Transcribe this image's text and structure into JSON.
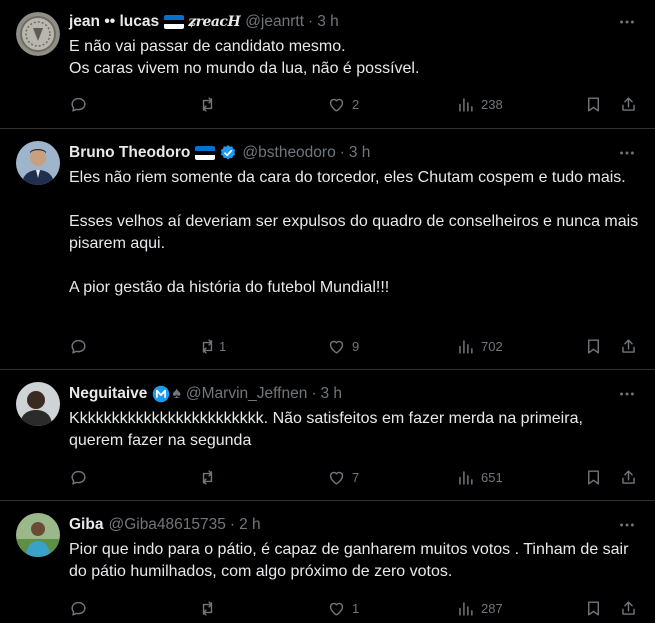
{
  "colors": {
    "background": "#000000",
    "text_primary": "#e7e9ea",
    "text_secondary": "#71767b",
    "divider": "#2f3336",
    "verified_blue": "#1d9bf0",
    "flag_stripes": [
      "#0072ce",
      "#000000",
      "#ffffff"
    ]
  },
  "tweets": [
    {
      "name": "jean •• lucas",
      "decoration": "ʑreacH",
      "handle": "@jeanrtt",
      "dot": "·",
      "time": "3 h",
      "text": "E não vai passar de candidato mesmo.\nOs caras vivem no mundo da lua, não é possível.",
      "replies": "",
      "retweets": "",
      "likes": "2",
      "views": "238",
      "avatar_icon": "coin-avatar",
      "badges": [
        "estonia-flag"
      ]
    },
    {
      "name": "Bruno Theodoro",
      "handle": "@bstheodoro",
      "dot": "·",
      "time": "3 h",
      "text": "Eles não riem somente da cara do torcedor, eles Chutam cospem e tudo mais.\n\nEsses velhos aí deveriam ser expulsos do quadro de conselheiros e nunca mais pisarem aqui.\n\nA pior gestão da história do futebol Mundial!!!",
      "replies": "",
      "retweets": "1",
      "likes": "9",
      "views": "702",
      "avatar_icon": "person-suit-avatar",
      "badges": [
        "estonia-flag",
        "verified-icon"
      ]
    },
    {
      "name": "Neguitaive",
      "handle": "@Marvin_Jeffnen",
      "dot": "·",
      "time": "3 h",
      "text": "Kkkkkkkkkkkkkkkkkkkkkkkk. Não satisfeitos em fazer merda na primeira, querem fazer na segunda",
      "replies": "",
      "retweets": "",
      "likes": "7",
      "views": "651",
      "avatar_icon": "person-avatar",
      "badges": [
        "m-badge-icon",
        "spade-icon"
      ]
    },
    {
      "name": "Giba",
      "handle": "@Giba48615735",
      "dot": "·",
      "time": "2 h",
      "text": "Pior que indo para o pátio, é capaz de ganharem muitos votos . Tinham de sair do pátio humilhados, com algo próximo de zero votos.",
      "replies": "",
      "retweets": "",
      "likes": "1",
      "views": "287",
      "avatar_icon": "person-field-avatar",
      "badges": []
    }
  ]
}
